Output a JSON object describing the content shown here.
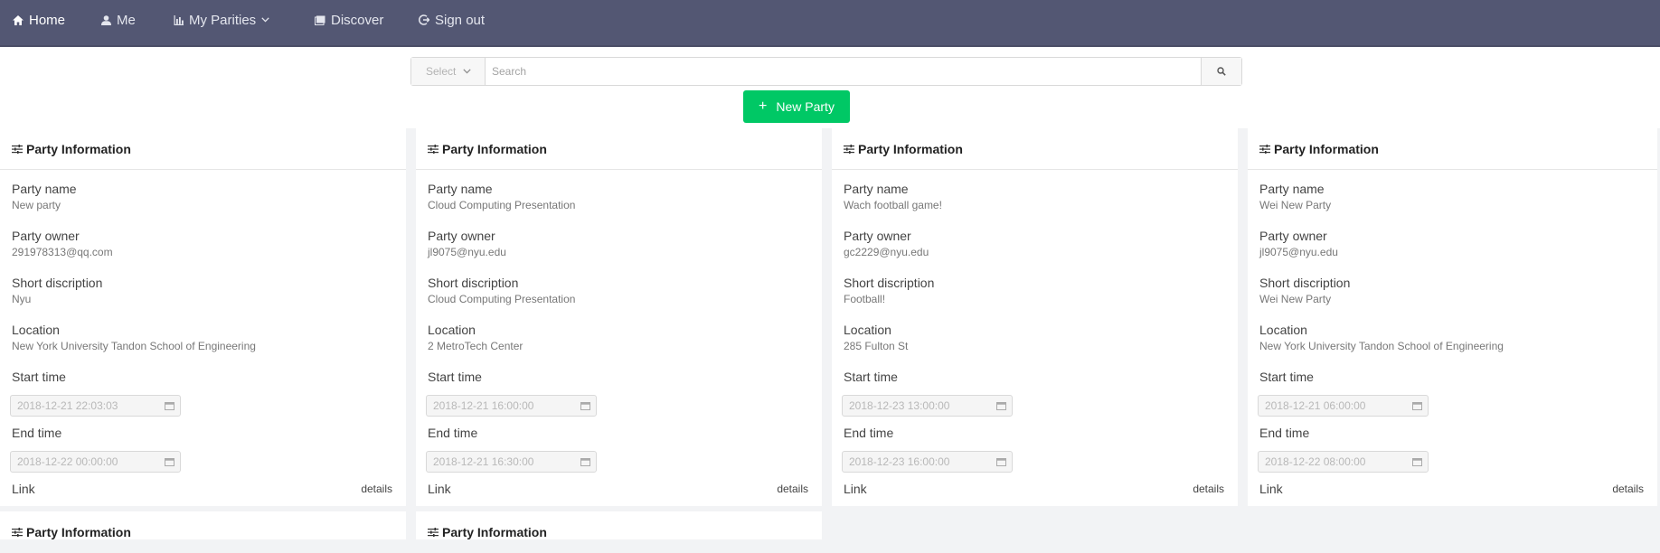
{
  "nav": {
    "home": "Home",
    "me": "Me",
    "my_parities": "My Parities",
    "discover": "Discover",
    "sign_out": "Sign out"
  },
  "search": {
    "select_label": "Select",
    "placeholder": "Search"
  },
  "new_party_label": "New Party",
  "card_labels": {
    "header": "Party Information",
    "party_name": "Party name",
    "party_owner": "Party owner",
    "short_description": "Short discription",
    "location": "Location",
    "start_time": "Start time",
    "end_time": "End time",
    "link": "Link",
    "details": "details"
  },
  "parties": [
    {
      "name": "New party",
      "owner": "291978313@qq.com",
      "description": "Nyu",
      "location": "New York University Tandon School of Engineering",
      "start": "2018-12-21 22:03:03",
      "end": "2018-12-22 00:00:00"
    },
    {
      "name": "Cloud Computing Presentation",
      "owner": "jl9075@nyu.edu",
      "description": "Cloud Computing Presentation",
      "location": "2 MetroTech Center",
      "start": "2018-12-21 16:00:00",
      "end": "2018-12-21 16:30:00"
    },
    {
      "name": "Wach football game!",
      "owner": "gc2229@nyu.edu",
      "description": "Football!",
      "location": "285 Fulton St",
      "start": "2018-12-23 13:00:00",
      "end": "2018-12-23 16:00:00"
    },
    {
      "name": "Wei New Party",
      "owner": "jl9075@nyu.edu",
      "description": "Wei New Party",
      "location": "New York University Tandon School of Engineering",
      "start": "2018-12-21 06:00:00",
      "end": "2018-12-22 08:00:00"
    }
  ],
  "colors": {
    "navbar": "#535773",
    "new_party_button": "#00c865"
  }
}
